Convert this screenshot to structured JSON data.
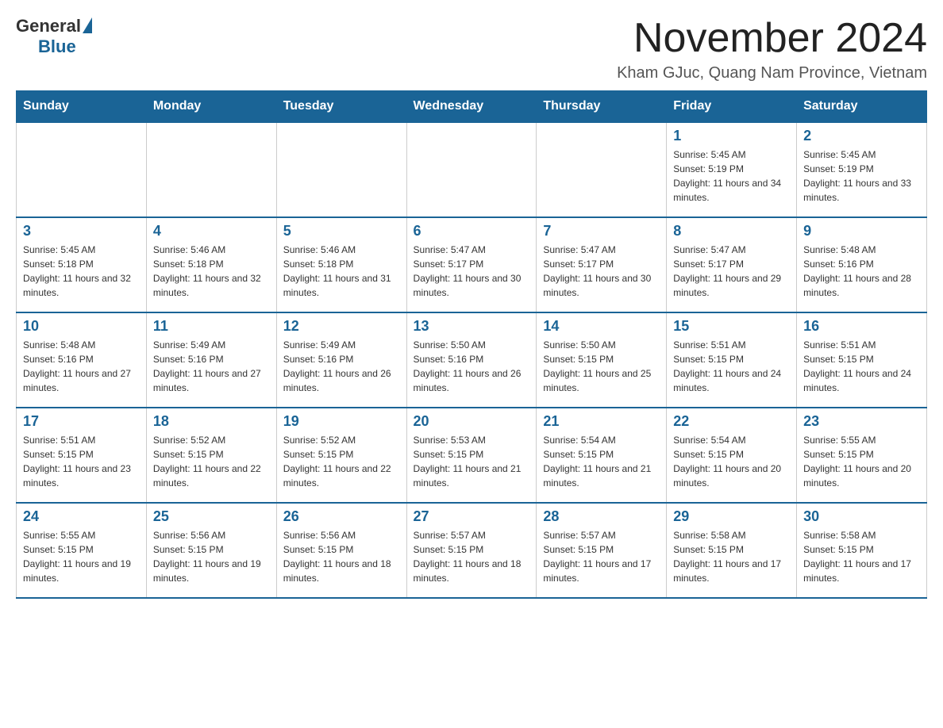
{
  "header": {
    "logo": {
      "text_general": "General",
      "text_blue": "Blue"
    },
    "title": "November 2024",
    "location": "Kham GJuc, Quang Nam Province, Vietnam"
  },
  "calendar": {
    "days_of_week": [
      "Sunday",
      "Monday",
      "Tuesday",
      "Wednesday",
      "Thursday",
      "Friday",
      "Saturday"
    ],
    "weeks": [
      {
        "days": [
          {
            "number": "",
            "info": ""
          },
          {
            "number": "",
            "info": ""
          },
          {
            "number": "",
            "info": ""
          },
          {
            "number": "",
            "info": ""
          },
          {
            "number": "",
            "info": ""
          },
          {
            "number": "1",
            "info": "Sunrise: 5:45 AM\nSunset: 5:19 PM\nDaylight: 11 hours and 34 minutes."
          },
          {
            "number": "2",
            "info": "Sunrise: 5:45 AM\nSunset: 5:19 PM\nDaylight: 11 hours and 33 minutes."
          }
        ]
      },
      {
        "days": [
          {
            "number": "3",
            "info": "Sunrise: 5:45 AM\nSunset: 5:18 PM\nDaylight: 11 hours and 32 minutes."
          },
          {
            "number": "4",
            "info": "Sunrise: 5:46 AM\nSunset: 5:18 PM\nDaylight: 11 hours and 32 minutes."
          },
          {
            "number": "5",
            "info": "Sunrise: 5:46 AM\nSunset: 5:18 PM\nDaylight: 11 hours and 31 minutes."
          },
          {
            "number": "6",
            "info": "Sunrise: 5:47 AM\nSunset: 5:17 PM\nDaylight: 11 hours and 30 minutes."
          },
          {
            "number": "7",
            "info": "Sunrise: 5:47 AM\nSunset: 5:17 PM\nDaylight: 11 hours and 30 minutes."
          },
          {
            "number": "8",
            "info": "Sunrise: 5:47 AM\nSunset: 5:17 PM\nDaylight: 11 hours and 29 minutes."
          },
          {
            "number": "9",
            "info": "Sunrise: 5:48 AM\nSunset: 5:16 PM\nDaylight: 11 hours and 28 minutes."
          }
        ]
      },
      {
        "days": [
          {
            "number": "10",
            "info": "Sunrise: 5:48 AM\nSunset: 5:16 PM\nDaylight: 11 hours and 27 minutes."
          },
          {
            "number": "11",
            "info": "Sunrise: 5:49 AM\nSunset: 5:16 PM\nDaylight: 11 hours and 27 minutes."
          },
          {
            "number": "12",
            "info": "Sunrise: 5:49 AM\nSunset: 5:16 PM\nDaylight: 11 hours and 26 minutes."
          },
          {
            "number": "13",
            "info": "Sunrise: 5:50 AM\nSunset: 5:16 PM\nDaylight: 11 hours and 26 minutes."
          },
          {
            "number": "14",
            "info": "Sunrise: 5:50 AM\nSunset: 5:15 PM\nDaylight: 11 hours and 25 minutes."
          },
          {
            "number": "15",
            "info": "Sunrise: 5:51 AM\nSunset: 5:15 PM\nDaylight: 11 hours and 24 minutes."
          },
          {
            "number": "16",
            "info": "Sunrise: 5:51 AM\nSunset: 5:15 PM\nDaylight: 11 hours and 24 minutes."
          }
        ]
      },
      {
        "days": [
          {
            "number": "17",
            "info": "Sunrise: 5:51 AM\nSunset: 5:15 PM\nDaylight: 11 hours and 23 minutes."
          },
          {
            "number": "18",
            "info": "Sunrise: 5:52 AM\nSunset: 5:15 PM\nDaylight: 11 hours and 22 minutes."
          },
          {
            "number": "19",
            "info": "Sunrise: 5:52 AM\nSunset: 5:15 PM\nDaylight: 11 hours and 22 minutes."
          },
          {
            "number": "20",
            "info": "Sunrise: 5:53 AM\nSunset: 5:15 PM\nDaylight: 11 hours and 21 minutes."
          },
          {
            "number": "21",
            "info": "Sunrise: 5:54 AM\nSunset: 5:15 PM\nDaylight: 11 hours and 21 minutes."
          },
          {
            "number": "22",
            "info": "Sunrise: 5:54 AM\nSunset: 5:15 PM\nDaylight: 11 hours and 20 minutes."
          },
          {
            "number": "23",
            "info": "Sunrise: 5:55 AM\nSunset: 5:15 PM\nDaylight: 11 hours and 20 minutes."
          }
        ]
      },
      {
        "days": [
          {
            "number": "24",
            "info": "Sunrise: 5:55 AM\nSunset: 5:15 PM\nDaylight: 11 hours and 19 minutes."
          },
          {
            "number": "25",
            "info": "Sunrise: 5:56 AM\nSunset: 5:15 PM\nDaylight: 11 hours and 19 minutes."
          },
          {
            "number": "26",
            "info": "Sunrise: 5:56 AM\nSunset: 5:15 PM\nDaylight: 11 hours and 18 minutes."
          },
          {
            "number": "27",
            "info": "Sunrise: 5:57 AM\nSunset: 5:15 PM\nDaylight: 11 hours and 18 minutes."
          },
          {
            "number": "28",
            "info": "Sunrise: 5:57 AM\nSunset: 5:15 PM\nDaylight: 11 hours and 17 minutes."
          },
          {
            "number": "29",
            "info": "Sunrise: 5:58 AM\nSunset: 5:15 PM\nDaylight: 11 hours and 17 minutes."
          },
          {
            "number": "30",
            "info": "Sunrise: 5:58 AM\nSunset: 5:15 PM\nDaylight: 11 hours and 17 minutes."
          }
        ]
      }
    ]
  }
}
